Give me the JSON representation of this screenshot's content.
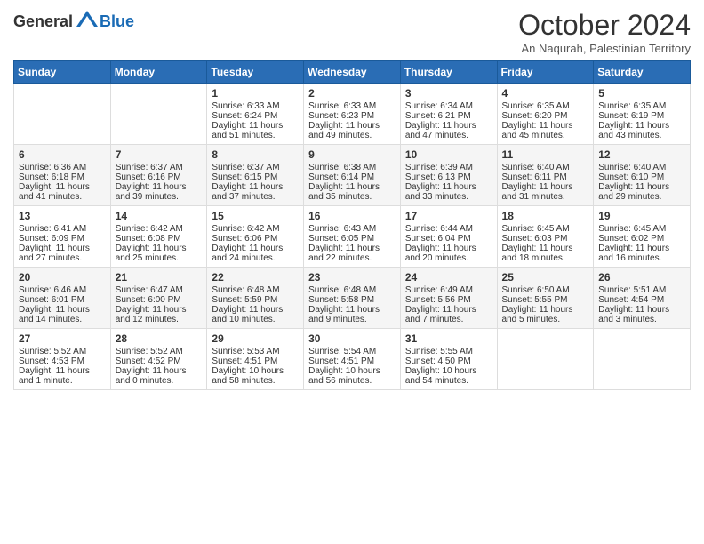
{
  "header": {
    "logo_general": "General",
    "logo_blue": "Blue",
    "month_title": "October 2024",
    "subtitle": "An Naqurah, Palestinian Territory"
  },
  "days_of_week": [
    "Sunday",
    "Monday",
    "Tuesday",
    "Wednesday",
    "Thursday",
    "Friday",
    "Saturday"
  ],
  "weeks": [
    [
      {
        "day": "",
        "sunrise": "",
        "sunset": "",
        "daylight": ""
      },
      {
        "day": "",
        "sunrise": "",
        "sunset": "",
        "daylight": ""
      },
      {
        "day": "1",
        "sunrise": "Sunrise: 6:33 AM",
        "sunset": "Sunset: 6:24 PM",
        "daylight": "Daylight: 11 hours and 51 minutes."
      },
      {
        "day": "2",
        "sunrise": "Sunrise: 6:33 AM",
        "sunset": "Sunset: 6:23 PM",
        "daylight": "Daylight: 11 hours and 49 minutes."
      },
      {
        "day": "3",
        "sunrise": "Sunrise: 6:34 AM",
        "sunset": "Sunset: 6:21 PM",
        "daylight": "Daylight: 11 hours and 47 minutes."
      },
      {
        "day": "4",
        "sunrise": "Sunrise: 6:35 AM",
        "sunset": "Sunset: 6:20 PM",
        "daylight": "Daylight: 11 hours and 45 minutes."
      },
      {
        "day": "5",
        "sunrise": "Sunrise: 6:35 AM",
        "sunset": "Sunset: 6:19 PM",
        "daylight": "Daylight: 11 hours and 43 minutes."
      }
    ],
    [
      {
        "day": "6",
        "sunrise": "Sunrise: 6:36 AM",
        "sunset": "Sunset: 6:18 PM",
        "daylight": "Daylight: 11 hours and 41 minutes."
      },
      {
        "day": "7",
        "sunrise": "Sunrise: 6:37 AM",
        "sunset": "Sunset: 6:16 PM",
        "daylight": "Daylight: 11 hours and 39 minutes."
      },
      {
        "day": "8",
        "sunrise": "Sunrise: 6:37 AM",
        "sunset": "Sunset: 6:15 PM",
        "daylight": "Daylight: 11 hours and 37 minutes."
      },
      {
        "day": "9",
        "sunrise": "Sunrise: 6:38 AM",
        "sunset": "Sunset: 6:14 PM",
        "daylight": "Daylight: 11 hours and 35 minutes."
      },
      {
        "day": "10",
        "sunrise": "Sunrise: 6:39 AM",
        "sunset": "Sunset: 6:13 PM",
        "daylight": "Daylight: 11 hours and 33 minutes."
      },
      {
        "day": "11",
        "sunrise": "Sunrise: 6:40 AM",
        "sunset": "Sunset: 6:11 PM",
        "daylight": "Daylight: 11 hours and 31 minutes."
      },
      {
        "day": "12",
        "sunrise": "Sunrise: 6:40 AM",
        "sunset": "Sunset: 6:10 PM",
        "daylight": "Daylight: 11 hours and 29 minutes."
      }
    ],
    [
      {
        "day": "13",
        "sunrise": "Sunrise: 6:41 AM",
        "sunset": "Sunset: 6:09 PM",
        "daylight": "Daylight: 11 hours and 27 minutes."
      },
      {
        "day": "14",
        "sunrise": "Sunrise: 6:42 AM",
        "sunset": "Sunset: 6:08 PM",
        "daylight": "Daylight: 11 hours and 25 minutes."
      },
      {
        "day": "15",
        "sunrise": "Sunrise: 6:42 AM",
        "sunset": "Sunset: 6:06 PM",
        "daylight": "Daylight: 11 hours and 24 minutes."
      },
      {
        "day": "16",
        "sunrise": "Sunrise: 6:43 AM",
        "sunset": "Sunset: 6:05 PM",
        "daylight": "Daylight: 11 hours and 22 minutes."
      },
      {
        "day": "17",
        "sunrise": "Sunrise: 6:44 AM",
        "sunset": "Sunset: 6:04 PM",
        "daylight": "Daylight: 11 hours and 20 minutes."
      },
      {
        "day": "18",
        "sunrise": "Sunrise: 6:45 AM",
        "sunset": "Sunset: 6:03 PM",
        "daylight": "Daylight: 11 hours and 18 minutes."
      },
      {
        "day": "19",
        "sunrise": "Sunrise: 6:45 AM",
        "sunset": "Sunset: 6:02 PM",
        "daylight": "Daylight: 11 hours and 16 minutes."
      }
    ],
    [
      {
        "day": "20",
        "sunrise": "Sunrise: 6:46 AM",
        "sunset": "Sunset: 6:01 PM",
        "daylight": "Daylight: 11 hours and 14 minutes."
      },
      {
        "day": "21",
        "sunrise": "Sunrise: 6:47 AM",
        "sunset": "Sunset: 6:00 PM",
        "daylight": "Daylight: 11 hours and 12 minutes."
      },
      {
        "day": "22",
        "sunrise": "Sunrise: 6:48 AM",
        "sunset": "Sunset: 5:59 PM",
        "daylight": "Daylight: 11 hours and 10 minutes."
      },
      {
        "day": "23",
        "sunrise": "Sunrise: 6:48 AM",
        "sunset": "Sunset: 5:58 PM",
        "daylight": "Daylight: 11 hours and 9 minutes."
      },
      {
        "day": "24",
        "sunrise": "Sunrise: 6:49 AM",
        "sunset": "Sunset: 5:56 PM",
        "daylight": "Daylight: 11 hours and 7 minutes."
      },
      {
        "day": "25",
        "sunrise": "Sunrise: 6:50 AM",
        "sunset": "Sunset: 5:55 PM",
        "daylight": "Daylight: 11 hours and 5 minutes."
      },
      {
        "day": "26",
        "sunrise": "Sunrise: 5:51 AM",
        "sunset": "Sunset: 4:54 PM",
        "daylight": "Daylight: 11 hours and 3 minutes."
      }
    ],
    [
      {
        "day": "27",
        "sunrise": "Sunrise: 5:52 AM",
        "sunset": "Sunset: 4:53 PM",
        "daylight": "Daylight: 11 hours and 1 minute."
      },
      {
        "day": "28",
        "sunrise": "Sunrise: 5:52 AM",
        "sunset": "Sunset: 4:52 PM",
        "daylight": "Daylight: 11 hours and 0 minutes."
      },
      {
        "day": "29",
        "sunrise": "Sunrise: 5:53 AM",
        "sunset": "Sunset: 4:51 PM",
        "daylight": "Daylight: 10 hours and 58 minutes."
      },
      {
        "day": "30",
        "sunrise": "Sunrise: 5:54 AM",
        "sunset": "Sunset: 4:51 PM",
        "daylight": "Daylight: 10 hours and 56 minutes."
      },
      {
        "day": "31",
        "sunrise": "Sunrise: 5:55 AM",
        "sunset": "Sunset: 4:50 PM",
        "daylight": "Daylight: 10 hours and 54 minutes."
      },
      {
        "day": "",
        "sunrise": "",
        "sunset": "",
        "daylight": ""
      },
      {
        "day": "",
        "sunrise": "",
        "sunset": "",
        "daylight": ""
      }
    ]
  ]
}
